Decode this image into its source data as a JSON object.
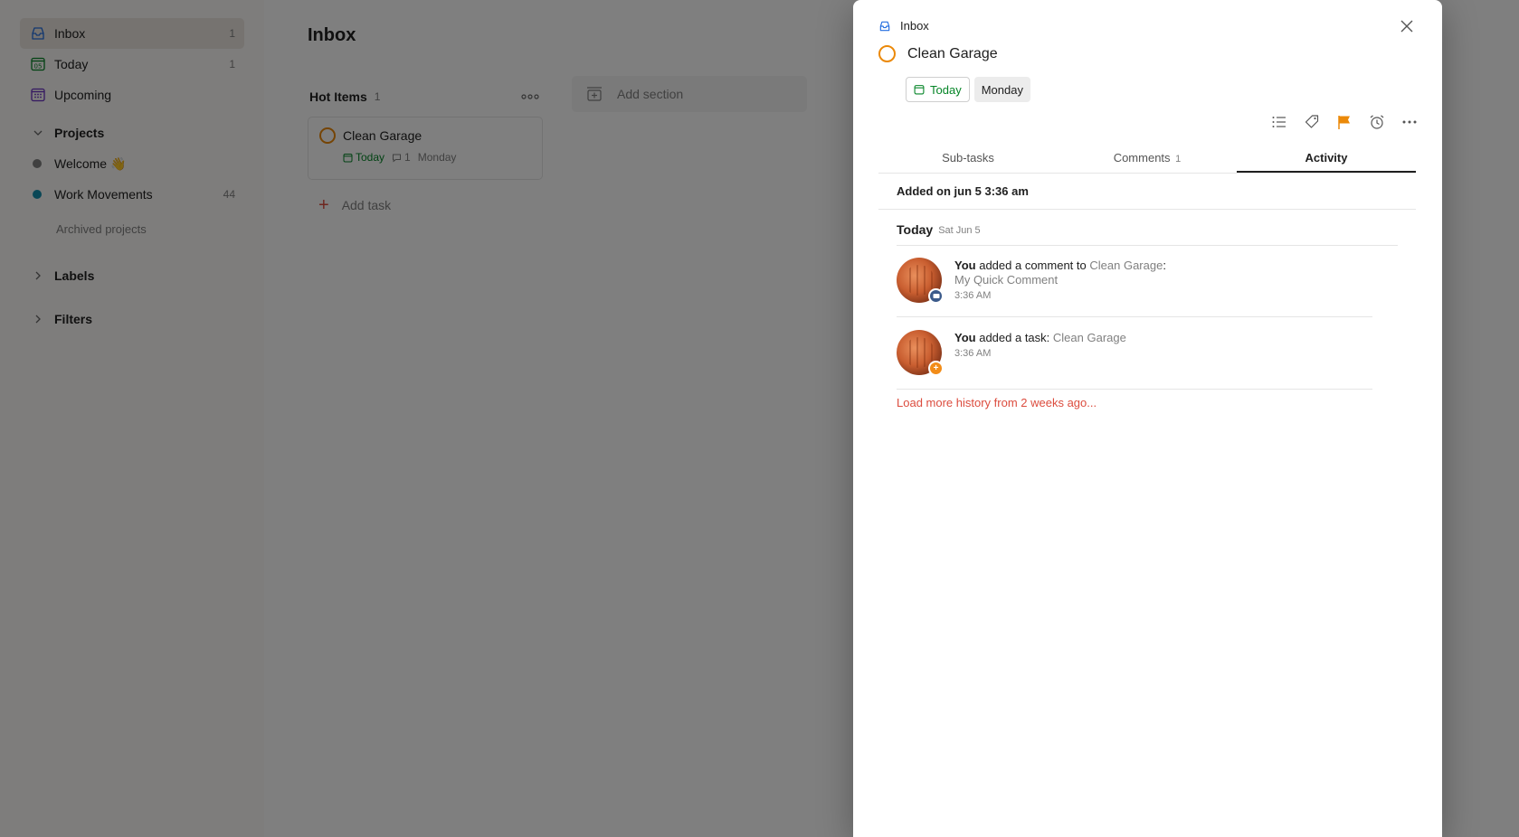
{
  "sidebar": {
    "nav": [
      {
        "label": "Inbox",
        "count": "1"
      },
      {
        "label": "Today",
        "count": "1"
      },
      {
        "label": "Upcoming",
        "count": ""
      }
    ],
    "today_icon_text": "05",
    "projects_label": "Projects",
    "projects": [
      {
        "label": "Welcome 👋",
        "count": "",
        "color": "#808080"
      },
      {
        "label": "Work Movements",
        "count": "44",
        "color": "#158fad"
      }
    ],
    "archived_label": "Archived projects",
    "labels_label": "Labels",
    "filters_label": "Filters"
  },
  "main": {
    "title": "Inbox",
    "section": {
      "title": "Hot Items",
      "count": "1"
    },
    "card": {
      "title": "Clean Garage",
      "date": "Today",
      "comments": "1",
      "day": "Monday"
    },
    "add_task_label": "Add task",
    "add_section_label": "Add section"
  },
  "modal": {
    "breadcrumb": "Inbox",
    "task_title": "Clean Garage",
    "chip_today": "Today",
    "chip_day": "Monday",
    "tabs": [
      {
        "label": "Sub-tasks",
        "count": ""
      },
      {
        "label": "Comments",
        "count": "1"
      },
      {
        "label": "Activity",
        "count": ""
      }
    ],
    "added_on": "Added on jun 5 3:36 am",
    "day_title": "Today",
    "day_sub": "Sat Jun 5",
    "events": [
      {
        "actor": "You",
        "action": "added a comment to",
        "target": "Clean Garage",
        "sep": ":",
        "detail": "My Quick Comment",
        "time": "3:36 AM"
      },
      {
        "actor": "You",
        "action": "added a task:",
        "target": "Clean Garage",
        "time": "3:36 AM"
      }
    ],
    "load_more": "Load more history from 2 weeks ago..."
  },
  "colors": {
    "accent_red": "#dc4c3e",
    "today_green": "#058527",
    "priority_orange": "#eb8909"
  }
}
